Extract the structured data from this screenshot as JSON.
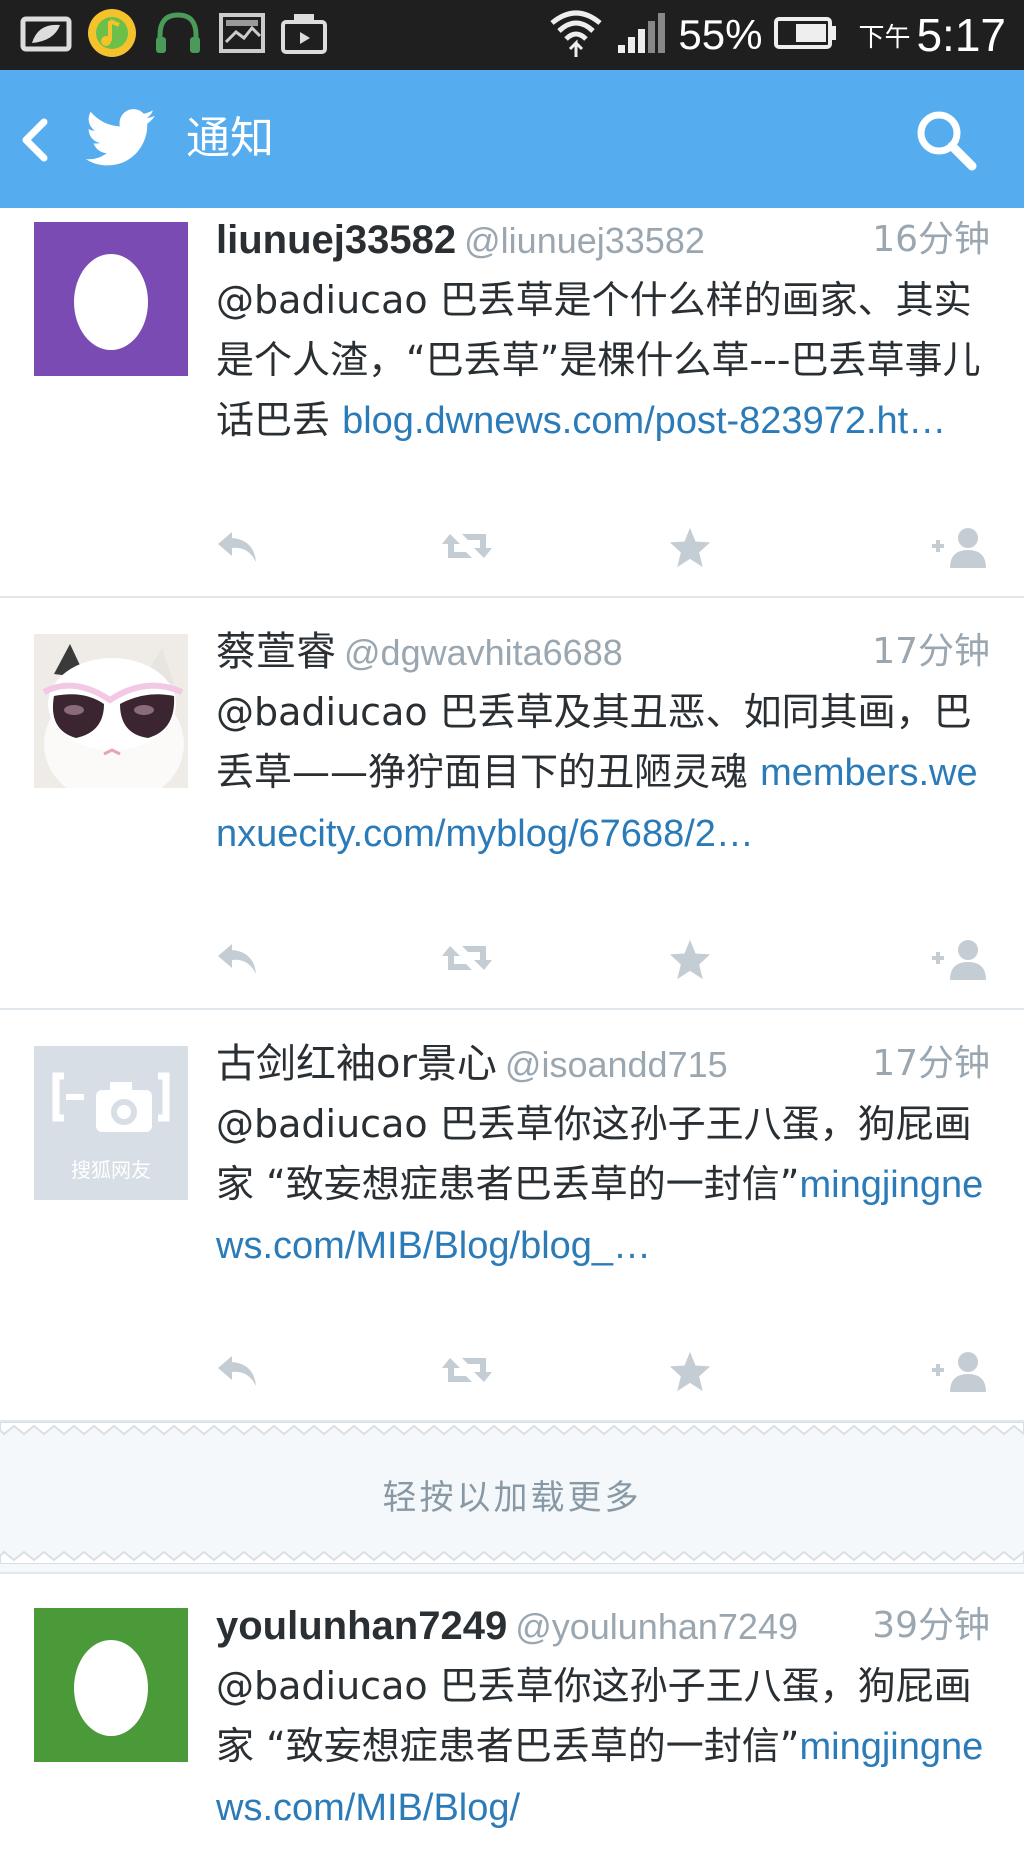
{
  "status_bar": {
    "battery_percent": "55%",
    "ampm": "下午",
    "time": "5:17",
    "icons": [
      "leaf-notification-icon",
      "music-app-icon",
      "headphones-icon",
      "image-icon",
      "upload-icon",
      "wifi-icon",
      "signal-icon",
      "battery-icon"
    ]
  },
  "app_bar": {
    "title": "通知",
    "back_icon": "chevron-left-icon",
    "logo_icon": "twitter-bird-icon",
    "search_icon": "search-icon"
  },
  "tweets": [
    {
      "name": "liunuej33582",
      "handle": "@liunuej33582",
      "time": "16分钟",
      "text": "@badiucao 巴丢草是个什么样的画家、其实是个人渣，“巴丢草”是棵什么草---巴丢草事儿话巴丢 ",
      "link": "blog.dwnews.com/post-823972.ht…",
      "avatar": "egg-avatar",
      "avatar_color": "#7b4bb4"
    },
    {
      "name": "蔡萱睿",
      "handle": "@dgwavhita6688",
      "time": "17分钟",
      "text": "@badiucao 巴丢草及其丑恶、如同其画，巴丢草——狰狞面目下的丑陋灵魂 ",
      "link": "members.wenxuecity.com/myblog/67688/2…",
      "avatar": "cat-sunglasses-avatar"
    },
    {
      "name": "古剑红袖or景心",
      "handle": "@isoandd715",
      "time": "17分钟",
      "text": "@badiucao 巴丢草你这孙子王八蛋，狗屁画家 “致妄想症患者巴丢草的一封信”",
      "link": "mingjingnews.com/MIB/Blog/blog_…",
      "avatar": "sohu-default-avatar",
      "avatar_caption": "搜狐网友"
    },
    {
      "name": "youlunhan7249",
      "handle": "@youlunhan7249",
      "time": "39分钟",
      "text": "@badiucao 巴丢草你这孙子王八蛋，狗屁画家 “致妄想症患者巴丢草的一封信”",
      "link": "mingjingnews.com/MIB/Blog/",
      "avatar": "egg-avatar",
      "avatar_color": "#4a9a3a"
    }
  ],
  "tweet_actions": [
    "reply-icon",
    "retweet-icon",
    "favorite-star-icon",
    "follow-add-user-icon"
  ],
  "load_more": {
    "label": "轻按以加载更多"
  },
  "colors": {
    "app_bar": "#55acee",
    "link": "#2b7bb9",
    "muted": "#9aa6b0",
    "text": "#292f33"
  }
}
